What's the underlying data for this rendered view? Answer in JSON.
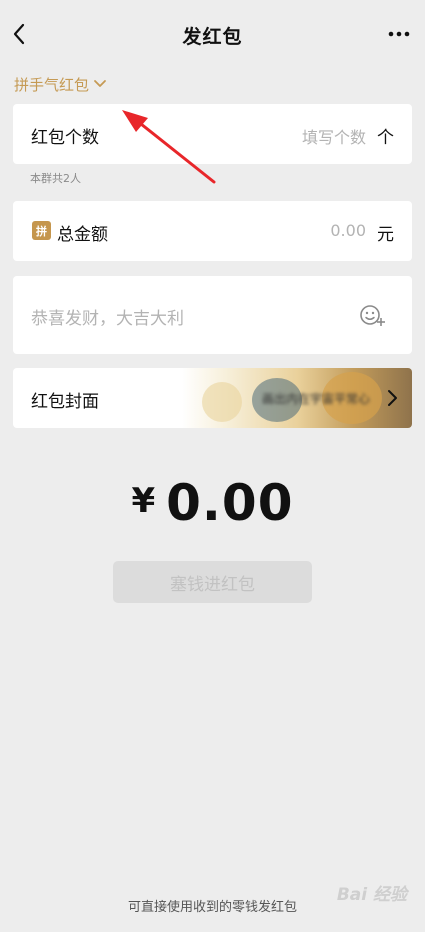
{
  "nav": {
    "title": "发红包",
    "back_icon": "chevron-left-icon",
    "more_icon": "more-dots-icon"
  },
  "packet_type": {
    "label": "拼手气红包",
    "icon": "chevron-down-icon",
    "color": "#c59a54"
  },
  "count_row": {
    "label": "红包个数",
    "placeholder": "填写个数",
    "unit": "个"
  },
  "group_hint": "本群共2人",
  "amount_row": {
    "badge": "拼",
    "label": "总金额",
    "value": "0.00",
    "unit": "元"
  },
  "message_row": {
    "placeholder": "恭喜发财，大吉大利",
    "icon": "emoji-add-icon"
  },
  "cover_row": {
    "label": "红包封面",
    "cover_text": "画出内在宇宙平常心",
    "icon": "chevron-right-icon"
  },
  "total": {
    "currency": "¥",
    "amount": "0.00"
  },
  "send_button": "塞钱进红包",
  "footer_note": "可直接使用收到的零钱发红包",
  "watermark": "Bai 经验",
  "annotation": {
    "icon": "red-arrow-icon",
    "color": "#e8262a"
  }
}
